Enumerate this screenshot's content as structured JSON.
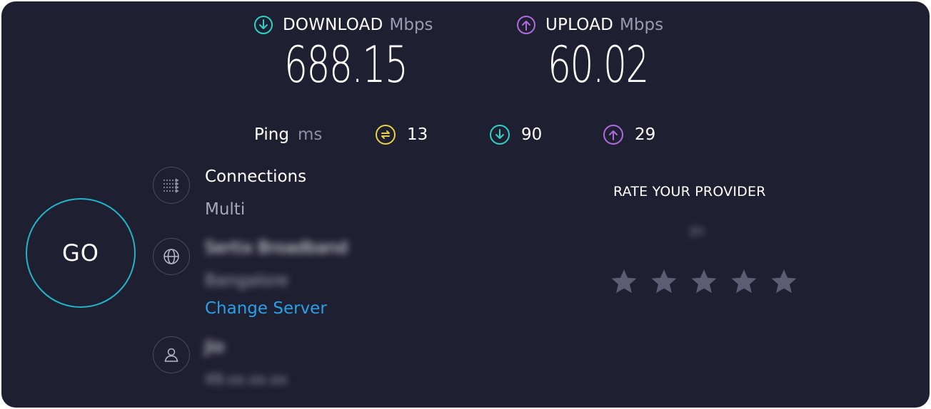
{
  "download": {
    "label": "DOWNLOAD",
    "unit": "Mbps",
    "value": "688.15",
    "icon": "arrow-down-circle-icon",
    "color": "#2fd1c4"
  },
  "upload": {
    "label": "UPLOAD",
    "unit": "Mbps",
    "value": "60.02",
    "icon": "arrow-up-circle-icon",
    "color": "#b06ae0"
  },
  "ping": {
    "label": "Ping",
    "unit": "ms",
    "idle": {
      "value": "13",
      "icon": "ping-idle-icon",
      "color": "#e5d24a"
    },
    "download_latency": {
      "value": "90",
      "icon": "arrow-down-circle-icon",
      "color": "#2fd1c4"
    },
    "upload_latency": {
      "value": "29",
      "icon": "arrow-up-circle-icon",
      "color": "#b06ae0"
    }
  },
  "go_button": {
    "label": "GO"
  },
  "connections": {
    "title": "Connections",
    "value": "Multi",
    "icon": "connections-icon"
  },
  "server": {
    "provider": "Sertix Broadband",
    "location": "Bangalore",
    "change_link": "Change Server",
    "icon": "globe-icon"
  },
  "user": {
    "provider": "Jio",
    "ip": "49.xx.xx.xx",
    "icon": "user-icon"
  },
  "rating": {
    "heading": "RATE YOUR PROVIDER",
    "provider": "Jio",
    "stars_total": 5,
    "star_color": "#5c5c72"
  },
  "colors": {
    "background": "#1f1f32",
    "accent_link": "#2aa0e6",
    "go_ring": "#22b4c8"
  }
}
